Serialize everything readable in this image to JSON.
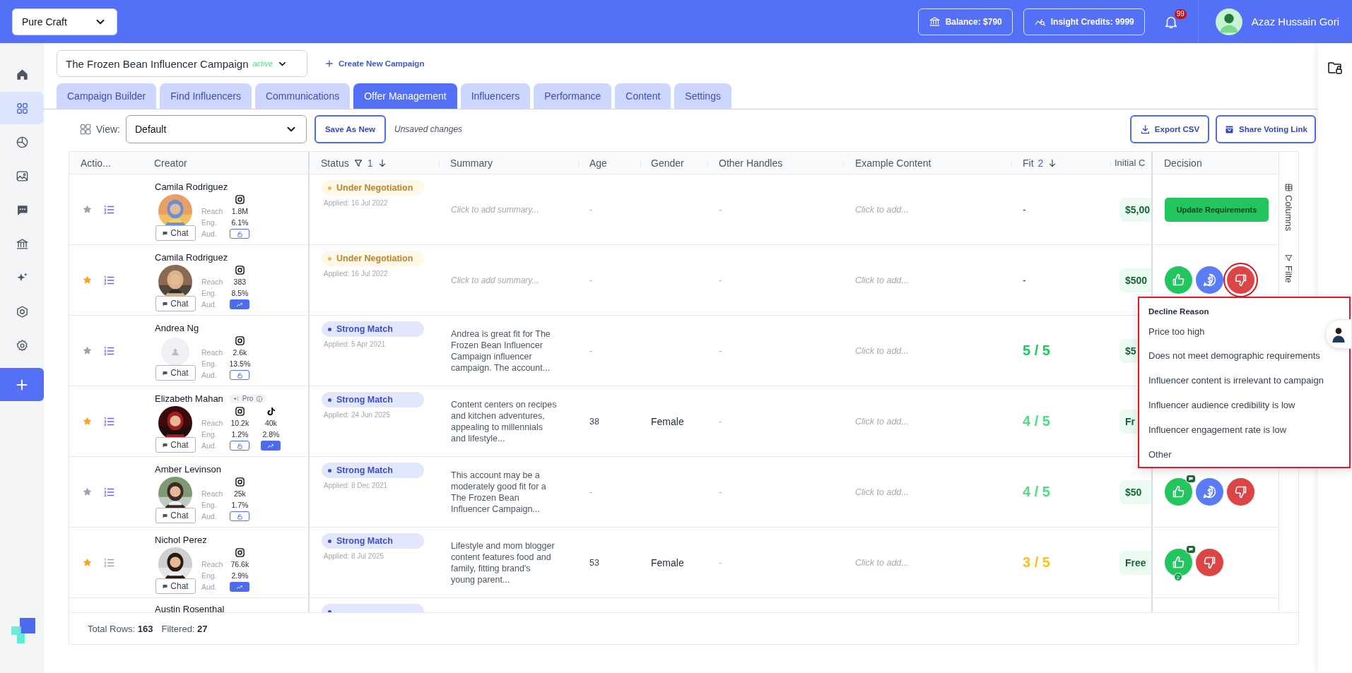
{
  "workspace": {
    "label": "Pure Craft"
  },
  "header": {
    "balance": "Balance: $790",
    "credits": "Insight Credits: 9999",
    "notifications": "99",
    "user": "Azaz Hussain Gori"
  },
  "sidebar": {
    "items": [
      {
        "kind": "home",
        "selected": false
      },
      {
        "kind": "dashboard",
        "selected": true
      },
      {
        "kind": "analytics",
        "selected": false
      },
      {
        "kind": "media",
        "selected": false
      },
      {
        "kind": "messages",
        "selected": false
      },
      {
        "kind": "bank",
        "selected": false
      },
      {
        "kind": "ai",
        "selected": false
      },
      {
        "kind": "hexagon",
        "selected": false
      },
      {
        "kind": "settings",
        "selected": false
      },
      {
        "kind": "add",
        "selected": false
      }
    ]
  },
  "campaign": {
    "name": "The Frozen Bean Influencer Campaign",
    "status": "active",
    "create_link": "Create New Campaign"
  },
  "tabs": [
    {
      "label": "Campaign Builder",
      "selected": false
    },
    {
      "label": "Find Influencers",
      "selected": false
    },
    {
      "label": "Communications",
      "selected": false
    },
    {
      "label": "Offer Management",
      "selected": true
    },
    {
      "label": "Influencers",
      "selected": false
    },
    {
      "label": "Performance",
      "selected": false
    },
    {
      "label": "Content",
      "selected": false
    },
    {
      "label": "Settings",
      "selected": false
    }
  ],
  "toolbar": {
    "view_label": "View:",
    "view_value": "Default",
    "save_button": "Save As New",
    "unsaved_note": "Unsaved changes",
    "export_button": "Export CSV",
    "share_button": "Share Voting Link"
  },
  "table": {
    "columns": [
      {
        "label": "Actio...",
        "filtered": false,
        "sorted": false
      },
      {
        "label": "Creator",
        "filtered": false,
        "sorted": false
      },
      {
        "label": "Status",
        "filtered": true,
        "sort_order": "1",
        "sorted": true
      },
      {
        "label": "Summary",
        "filtered": false,
        "sorted": false
      },
      {
        "label": "Age",
        "filtered": false,
        "sorted": false
      },
      {
        "label": "Gender",
        "filtered": false,
        "sorted": false
      },
      {
        "label": "Other Handles",
        "filtered": false,
        "sorted": false
      },
      {
        "label": "Example Content",
        "filtered": false,
        "sorted": false
      },
      {
        "label": "Fit",
        "filtered": false,
        "sort_order": "2",
        "sorted": true
      },
      {
        "label": "Initial C",
        "filtered": false,
        "sorted": false
      },
      {
        "label": "Decision",
        "filtered": false,
        "sorted": false
      }
    ],
    "side_panel": {
      "columns": "Columns",
      "filters": "Filte"
    },
    "rows": [
      {
        "starred": false,
        "list_enabled": true,
        "name": "Camila Rodriguez",
        "photo": true,
        "chat": "Chat",
        "metric_labels": [
          "Reach",
          "Eng.",
          "Aud."
        ],
        "platforms": [
          {
            "kind": "instagram",
            "reach": "1.8M",
            "eng": "6.1%",
            "aud_locked": true
          }
        ],
        "status": {
          "kind": "negotiation",
          "label": "Under Negotiation",
          "applied": "Applied: 16 Jul 2022"
        },
        "summary": {
          "text": "Click to add summary...",
          "muted": true
        },
        "age": {
          "text": "-",
          "muted": true
        },
        "other_handles": {
          "text": "-",
          "muted": true
        },
        "example_content": {
          "text": "Click to add...",
          "muted": true
        },
        "fit": {
          "text": "-"
        },
        "initial_offer": "$5,00",
        "decision": {
          "kind": "button",
          "label": "Update Requirements"
        }
      },
      {
        "starred": true,
        "list_enabled": true,
        "name": "Camila Rodriguez",
        "photo": true,
        "chat": "Chat",
        "metric_labels": [
          "Reach",
          "Eng.",
          "Aud."
        ],
        "platforms": [
          {
            "kind": "instagram",
            "reach": "383",
            "eng": "8.5%",
            "aud_locked": false
          }
        ],
        "status": {
          "kind": "negotiation",
          "label": "Under Negotiation",
          "applied": "Applied: 16 Jul 2022"
        },
        "summary": {
          "text": "Click to add summary...",
          "muted": true
        },
        "age": {
          "text": "-",
          "muted": true
        },
        "other_handles": {
          "text": "-",
          "muted": true
        },
        "example_content": {
          "text": "Click to add...",
          "muted": true
        },
        "fit": {
          "text": "-"
        },
        "initial_offer": "$500",
        "decision": {
          "kind": "actions",
          "actions": [
            {
              "kind": "accept",
              "comment": false,
              "highlighted": false
            },
            {
              "kind": "counter",
              "comment": false,
              "highlighted": false
            },
            {
              "kind": "decline",
              "comment": false,
              "highlighted": true
            }
          ]
        }
      },
      {
        "starred": false,
        "list_enabled": true,
        "name": "Andrea Ng",
        "photo": false,
        "chat": "Chat",
        "metric_labels": [
          "Reach",
          "Eng.",
          "Aud."
        ],
        "platforms": [
          {
            "kind": "instagram",
            "reach": "2.6k",
            "eng": "13.5%",
            "aud_locked": true
          }
        ],
        "status": {
          "kind": "match",
          "label": "Strong Match",
          "applied": "Applied: 5 Apr 2021"
        },
        "summary": {
          "text": "Andrea is great fit for The Frozen Bean Influencer Campaign influencer campaign. The account...",
          "muted": false
        },
        "age": {
          "text": "-",
          "muted": true
        },
        "other_handles": {
          "text": "-",
          "muted": true
        },
        "example_content": {
          "text": "Click to add...",
          "muted": true
        },
        "fit": {
          "text": "5 / 5",
          "color": "#22c55e"
        },
        "initial_offer": "$5"
      },
      {
        "starred": true,
        "list_enabled": true,
        "name": "Elizabeth Mahan",
        "pro_badge": "Pro",
        "photo": true,
        "chat": "Chat",
        "metric_labels": [
          "Reach",
          "Eng.",
          "Aud."
        ],
        "platforms": [
          {
            "kind": "instagram",
            "reach": "10.2k",
            "eng": "1.2%",
            "aud_locked": true
          },
          {
            "kind": "tiktok",
            "reach": "40k",
            "eng": "2.8%",
            "aud_locked": false
          }
        ],
        "status": {
          "kind": "match",
          "label": "Strong Match",
          "applied": "Applied: 24 Jun 2025"
        },
        "summary": {
          "text": "Content centers on recipes and kitchen adventures, appealing to millennials and lifestyle...",
          "muted": false
        },
        "age": {
          "text": "38",
          "muted": false
        },
        "gender": "Female",
        "other_handles": {
          "text": "-",
          "muted": true
        },
        "example_content": {
          "text": "Click to add...",
          "muted": true
        },
        "fit": {
          "text": "4 / 5",
          "color": "#4ade80"
        },
        "initial_offer": "Fr"
      },
      {
        "starred": false,
        "list_enabled": true,
        "name": "Amber Levinson",
        "photo": true,
        "chat": "Chat",
        "metric_labels": [
          "Reach",
          "Eng.",
          "Aud."
        ],
        "platforms": [
          {
            "kind": "instagram",
            "reach": "25k",
            "eng": "1.7%",
            "aud_locked": true
          }
        ],
        "status": {
          "kind": "match",
          "label": "Strong Match",
          "applied": "Applied: 8 Dec 2021"
        },
        "summary": {
          "text": "This account may be a moderately good fit for a The Frozen Bean Influencer Campaign...",
          "muted": false
        },
        "age": {
          "text": "-",
          "muted": true
        },
        "other_handles": {
          "text": "-",
          "muted": true
        },
        "example_content": {
          "text": "Click to add...",
          "muted": true
        },
        "fit": {
          "text": "4 / 5",
          "color": "#4ade80"
        },
        "initial_offer": "$50",
        "decision": {
          "kind": "actions",
          "actions": [
            {
              "kind": "accept",
              "comment": true,
              "highlighted": false
            },
            {
              "kind": "counter",
              "comment": false,
              "highlighted": false
            },
            {
              "kind": "decline",
              "comment": false,
              "highlighted": false
            }
          ]
        }
      },
      {
        "starred": true,
        "list_enabled": false,
        "name": "Nichol Perez",
        "photo": true,
        "chat": "Chat",
        "metric_labels": [
          "Reach",
          "Eng.",
          "Aud."
        ],
        "platforms": [
          {
            "kind": "instagram",
            "reach": "76.6k",
            "eng": "2.9%",
            "aud_locked": false
          }
        ],
        "status": {
          "kind": "match",
          "label": "Strong Match",
          "applied": "Applied: 8 Jul 2025"
        },
        "summary": {
          "text": "Lifestyle and mom blogger content features food and family, fitting brand's young parent...",
          "muted": false
        },
        "age": {
          "text": "53",
          "muted": false
        },
        "gender": "Female",
        "other_handles": {
          "text": "-",
          "muted": true
        },
        "example_content": {
          "text": "Click to add...",
          "muted": true
        },
        "fit": {
          "text": "3 / 5",
          "color": "#fbbf24"
        },
        "initial_offer": "Free",
        "decision": {
          "kind": "actions",
          "actions": [
            {
              "kind": "accept",
              "comment": true,
              "count": "2",
              "highlighted": false
            },
            {
              "kind": "decline",
              "comment": false,
              "highlighted": false
            }
          ]
        }
      }
    ],
    "cut_row": {
      "name": "Austin Rosenthal",
      "status": {
        "kind": "match"
      }
    },
    "footer": {
      "total": "Total Rows: **163**",
      "filtered": "Filtered: **27**"
    }
  },
  "decline_menu": {
    "title": "Decline Reason",
    "options": [
      "Price too high",
      "Does not meet demographic requirements",
      "Influencer content is irrelevant to campaign",
      "Influencer audience credibility is low",
      "Influencer engagement rate is low",
      "Other"
    ]
  }
}
